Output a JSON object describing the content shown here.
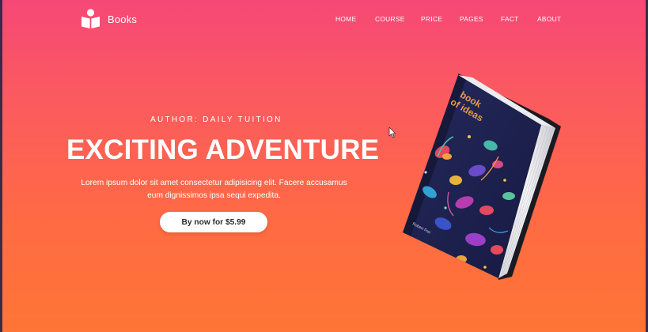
{
  "brand": {
    "name": "Books",
    "icon": "open-book-reader-icon"
  },
  "nav": {
    "items": [
      {
        "label": "HOME"
      },
      {
        "label": "COURSE"
      },
      {
        "label": "PRICE"
      },
      {
        "label": "PAGES"
      },
      {
        "label": "FACT"
      },
      {
        "label": "ABOUT"
      }
    ]
  },
  "hero": {
    "author": "AUTHOR: DAILY TUITION",
    "title": "EXCITING ADVENTURE",
    "description": "Lorem ipsum dolor sit amet consectetur adipisicing elit. Facere accusamus eum dignissimos ipsa sequi expedita.",
    "cta_label": "By now for $5.99"
  },
  "book": {
    "cover_title_line1": "book",
    "cover_title_line2": "of ideas",
    "cover_author": "Robert Frei"
  },
  "colors": {
    "gradient_top": "#f64876",
    "gradient_bottom": "#ff7535",
    "cover": "#1e2150"
  }
}
